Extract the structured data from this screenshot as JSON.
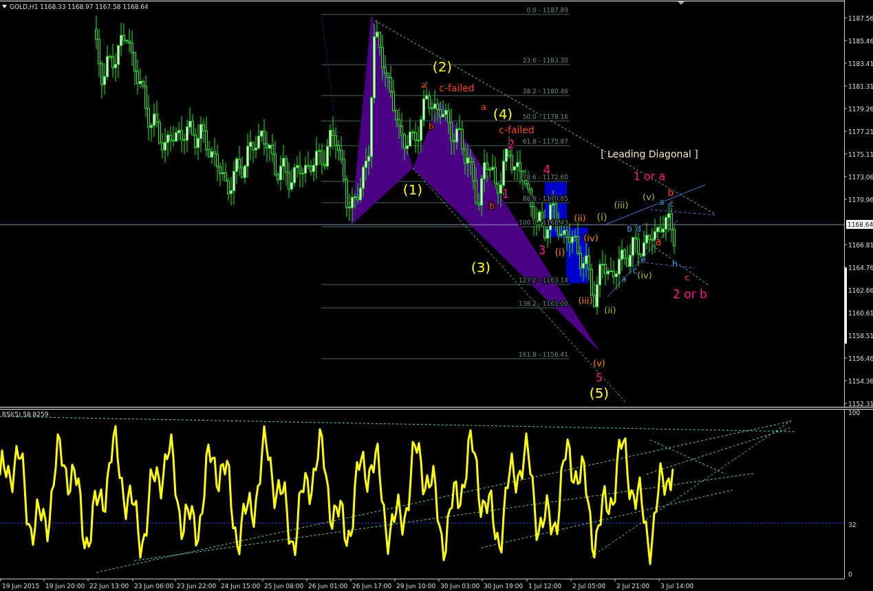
{
  "header": {
    "symbol": "GOLD,H1",
    "open": "1168.33",
    "high": "1168.97",
    "low": "1167.58",
    "close": "1168.64"
  },
  "price_axis": {
    "labels": [
      "1187.56",
      "1185.46",
      "1183.41",
      "1181.31",
      "1179.26",
      "1177.21",
      "1175.11",
      "1173.06",
      "1170.96",
      "1166.81",
      "1164.76",
      "1162.66",
      "1160.61",
      "1158.51",
      "1156.46",
      "1154.36",
      "1152.31"
    ],
    "current_price": "1168.64"
  },
  "fibonacci": {
    "levels": [
      "0.0 - 1187.89",
      "23.6 - 1183.30",
      "38.2 - 1180.46",
      "50.0 - 1178.16",
      "61.8 - 1175.87",
      "78.6 - 1172.60",
      "88.6 - 1170.65",
      "100.0 - 1168.43",
      "127.2 - 1163.14",
      "138.2 - 1161.00",
      "161.8 - 1156.41"
    ]
  },
  "pattern_title": "[ Leading Diagonal ]",
  "wave_labels": [
    {
      "text": "(2)",
      "color": "#ffff00"
    },
    {
      "text": "a",
      "color": "#ff4500"
    },
    {
      "text": "c-failed",
      "color": "#ff4500"
    },
    {
      "text": "a",
      "color": "#ff4500"
    },
    {
      "text": "(4)",
      "color": "#ffff00"
    },
    {
      "text": "b",
      "color": "#ff4500"
    },
    {
      "text": "c-failed",
      "color": "#ff4500"
    },
    {
      "text": "2",
      "color": "#ff1493"
    },
    {
      "text": "4",
      "color": "#ff1493"
    },
    {
      "text": "1 or a",
      "color": "#ff1493"
    },
    {
      "text": "(1)",
      "color": "#ffff00"
    },
    {
      "text": "b",
      "color": "#ff4500"
    },
    {
      "text": "1",
      "color": "#ff1493"
    },
    {
      "text": "(iii)",
      "color": "#aabb33"
    },
    {
      "text": "(v)",
      "color": "#aabb33"
    },
    {
      "text": "b",
      "color": "#ff4500"
    },
    {
      "text": "a",
      "color": "#33aaee"
    },
    {
      "text": "c",
      "color": "#33aaee"
    },
    {
      "text": "(i)",
      "color": "#aabb33"
    },
    {
      "text": "(ii)",
      "color": "#ff8c00"
    },
    {
      "text": "b",
      "color": "#33aaee"
    },
    {
      "text": "d",
      "color": "#33aaee"
    },
    {
      "text": "(iv)",
      "color": "#ff8c00"
    },
    {
      "text": "a",
      "color": "#ff4500"
    },
    {
      "text": "3",
      "color": "#ff1493"
    },
    {
      "text": "(i)",
      "color": "#ff8c00"
    },
    {
      "text": "(3)",
      "color": "#ffff00"
    },
    {
      "text": "e",
      "color": "#33aaee"
    },
    {
      "text": "h",
      "color": "#33aaee"
    },
    {
      "text": "a",
      "color": "#33aaee"
    },
    {
      "text": "c",
      "color": "#33aaee"
    },
    {
      "text": "(iv)",
      "color": "#aabb33"
    },
    {
      "text": "c",
      "color": "#ff4500"
    },
    {
      "text": "2 or b",
      "color": "#ff1493"
    },
    {
      "text": "(iii)",
      "color": "#ff8c00"
    },
    {
      "text": "(ii)",
      "color": "#aabb33"
    },
    {
      "text": "(v)",
      "color": "#ff8c00"
    },
    {
      "text": "5",
      "color": "#ff1493"
    },
    {
      "text": "(5)",
      "color": "#ffff00"
    }
  ],
  "rsi": {
    "label": "RSI(5) 58.8259",
    "axis_labels": [
      "100",
      "32",
      "0"
    ]
  },
  "time_axis": {
    "labels": [
      "19 Jun 2015",
      "19 Jun 20:00",
      "22 Jun 13:00",
      "23 Jun 06:00",
      "23 Jun 22:00",
      "24 Jun 15:00",
      "25 Jun 08:00",
      "26 Jun 01:00",
      "26 Jun 17:00",
      "29 Jun 10:00",
      "30 Jun 03:00",
      "30 Jun 19:00",
      "1 Jul 12:00",
      "2 Jul 05:00",
      "2 Jul 21:00",
      "3 Jul 14:00"
    ]
  }
}
